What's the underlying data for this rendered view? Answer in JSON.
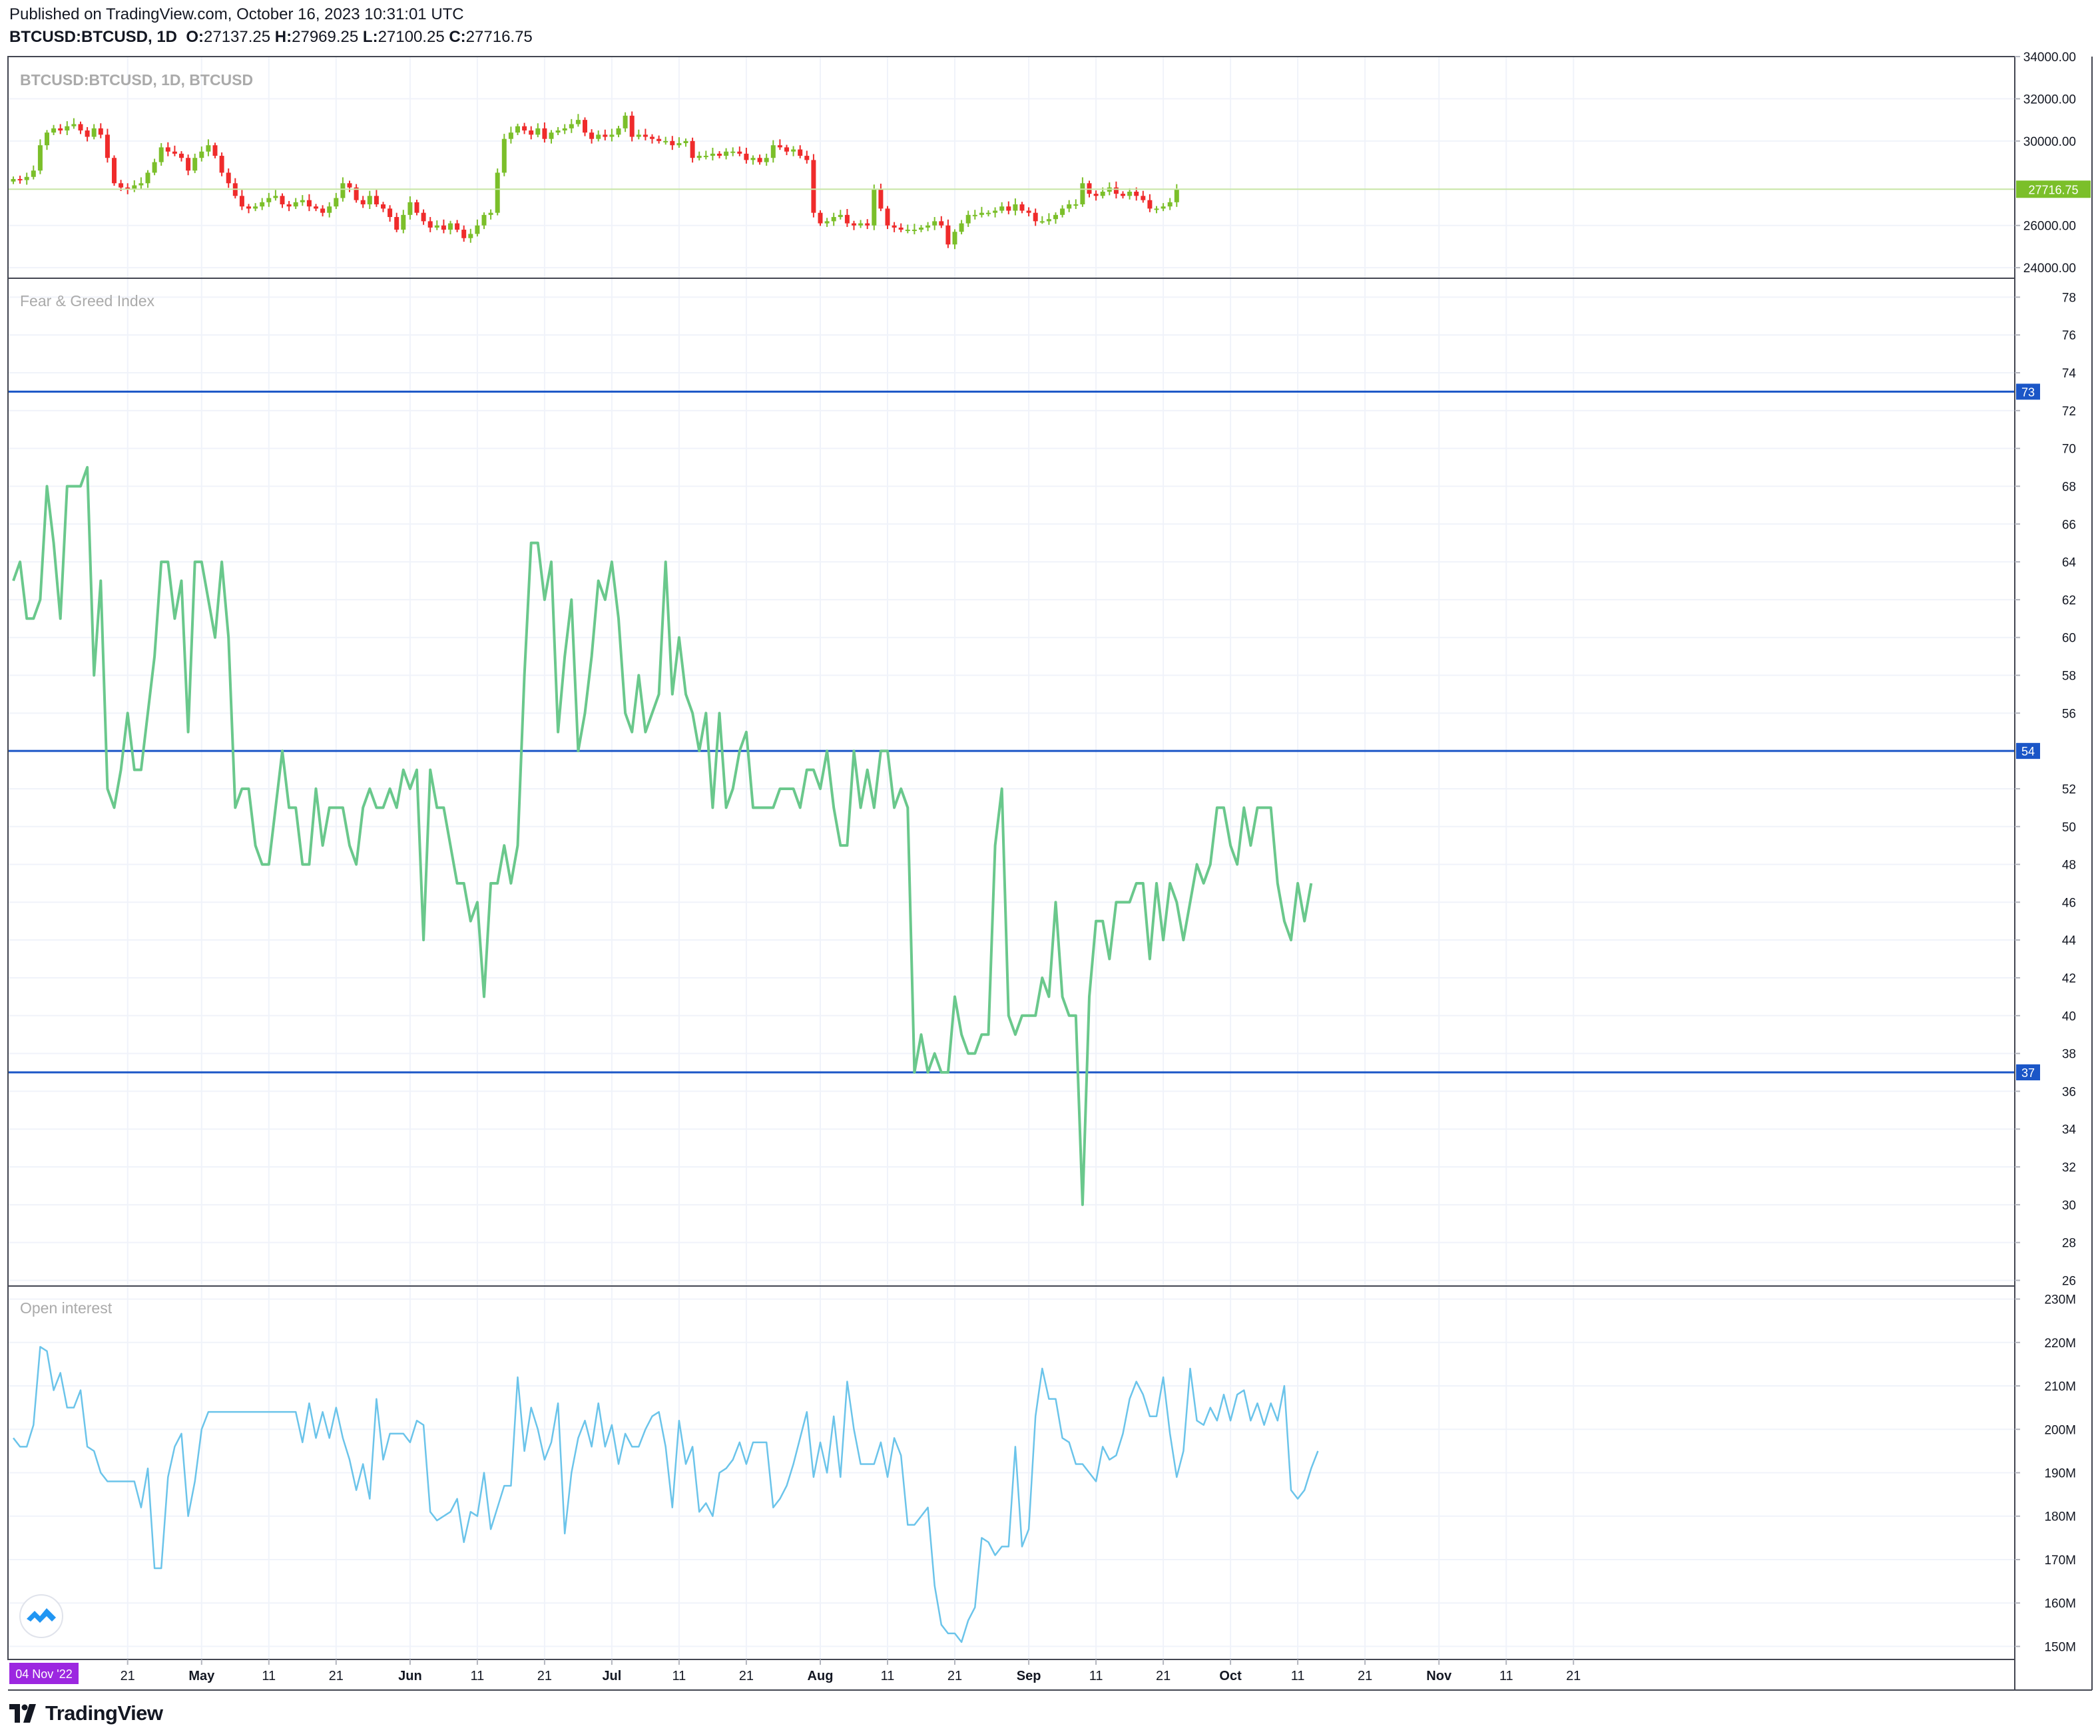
{
  "header": {
    "published": "Published on TradingView.com, October 16, 2023 10:31:01 UTC",
    "symbol": "BTCUSD:BTCUSD, 1D",
    "ohlc": {
      "o_label": "O:",
      "o": "27137.25",
      "h_label": "H:",
      "h": "27969.25",
      "l_label": "L:",
      "l": "27100.25",
      "c_label": "C:",
      "c": "27716.75"
    }
  },
  "footer": {
    "brand": "TradingView"
  },
  "colors": {
    "up": "#7bbf2a",
    "down": "#ef2b2b",
    "fng_line": "#6ac88c",
    "oi_line": "#6bc4ea",
    "hline": "#1b56c7",
    "last_price": "#7bbf2a",
    "date_badge": "#9c27e0",
    "grid": "#f0f3fa"
  },
  "x_axis": {
    "labels": [
      "21",
      "May",
      "11",
      "21",
      "Jun",
      "11",
      "21",
      "Jul",
      "11",
      "21",
      "Aug",
      "11",
      "21",
      "Sep",
      "11",
      "21",
      "Oct",
      "11",
      "21",
      "Nov",
      "11",
      "21"
    ],
    "first_date_badge": "04 Nov '22"
  },
  "chart_data": [
    {
      "type": "candlestick",
      "title": "BTCUSD:BTCUSD, 1D, BTCUSD",
      "y_ticks": [
        "34000.00",
        "32000.00",
        "30000.00",
        "26000.00",
        "24000.00"
      ],
      "ylim": [
        23500,
        34000
      ],
      "last_value_label": "27716.75",
      "last_value": 27716.75,
      "close": [
        28200,
        28150,
        28300,
        28600,
        29800,
        30400,
        30600,
        30500,
        30700,
        30800,
        30500,
        30200,
        30600,
        30300,
        29200,
        28000,
        27800,
        27700,
        27900,
        28000,
        28500,
        29000,
        29700,
        29500,
        29400,
        29200,
        28600,
        29200,
        29500,
        29800,
        29300,
        28500,
        28000,
        27400,
        26900,
        26800,
        26900,
        27100,
        27300,
        27400,
        27000,
        26900,
        27100,
        27200,
        26900,
        26800,
        26600,
        26900,
        27300,
        28000,
        27800,
        27200,
        27000,
        27400,
        27000,
        26800,
        26400,
        25800,
        26500,
        27100,
        26600,
        26200,
        25900,
        26000,
        25800,
        26100,
        25800,
        25400,
        25600,
        26000,
        26500,
        26600,
        28500,
        30100,
        30400,
        30700,
        30500,
        30300,
        30600,
        30100,
        30400,
        30500,
        30600,
        30800,
        31000,
        30400,
        30100,
        30300,
        30200,
        30300,
        30600,
        31200,
        30200,
        30300,
        30200,
        30100,
        30000,
        30000,
        29800,
        29900,
        30000,
        29200,
        29300,
        29300,
        29400,
        29300,
        29500,
        29500,
        29400,
        29100,
        29200,
        29000,
        29200,
        29800,
        29700,
        29500,
        29600,
        29300,
        29100,
        26600,
        26100,
        26200,
        26400,
        26500,
        26100,
        26000,
        26100,
        26000,
        27700,
        26800,
        26000,
        25900,
        25800,
        25800,
        25800,
        25900,
        26000,
        26200,
        26000,
        25100,
        25700,
        26100,
        26500,
        26500,
        26600,
        26600,
        26700,
        26900,
        26700,
        27000,
        26700,
        26600,
        26200,
        26200,
        26300,
        26500,
        26800,
        27000,
        27000,
        28000,
        27500,
        27400,
        27600,
        27800,
        27500,
        27400,
        27600,
        27400,
        27200,
        26800,
        26800,
        26900,
        27100,
        27716.75
      ]
    },
    {
      "type": "line",
      "title": "Fear & Greed Index",
      "y_ticks": [
        "78",
        "76",
        "74",
        "72",
        "70",
        "68",
        "66",
        "64",
        "62",
        "60",
        "58",
        "56",
        "52",
        "50",
        "48",
        "46",
        "44",
        "42",
        "40",
        "38",
        "36",
        "34",
        "32",
        "30",
        "28",
        "26"
      ],
      "ylim": [
        25.7,
        79
      ],
      "horizontal_lines": [
        73,
        54,
        37
      ],
      "y": [
        63,
        64,
        61,
        61,
        62,
        68,
        65,
        61,
        68,
        68,
        68,
        69,
        58,
        63,
        52,
        51,
        53,
        56,
        53,
        53,
        56,
        59,
        64,
        64,
        61,
        63,
        55,
        64,
        64,
        62,
        60,
        64,
        60,
        51,
        52,
        52,
        49,
        48,
        48,
        51,
        54,
        51,
        51,
        48,
        48,
        52,
        49,
        51,
        51,
        51,
        49,
        48,
        51,
        52,
        51,
        51,
        52,
        51,
        53,
        52,
        53,
        44,
        53,
        51,
        51,
        49,
        47,
        47,
        45,
        46,
        41,
        47,
        47,
        49,
        47,
        49,
        58,
        65,
        65,
        62,
        64,
        55,
        59,
        62,
        54,
        56,
        59,
        63,
        62,
        64,
        61,
        56,
        55,
        58,
        55,
        56,
        57,
        64,
        57,
        60,
        57,
        56,
        54,
        56,
        51,
        56,
        51,
        52,
        54,
        55,
        51,
        51,
        51,
        51,
        52,
        52,
        52,
        51,
        53,
        53,
        52,
        54,
        51,
        49,
        49,
        54,
        51,
        53,
        51,
        54,
        54,
        51,
        52,
        51,
        37,
        39,
        37,
        38,
        37,
        37,
        41,
        39,
        38,
        38,
        39,
        39,
        49,
        52,
        40,
        39,
        40,
        40,
        40,
        42,
        41,
        46,
        41,
        40,
        40,
        30,
        41,
        45,
        45,
        43,
        46,
        46,
        46,
        47,
        47,
        43,
        47,
        44,
        47,
        46,
        44,
        46,
        48,
        47,
        48,
        51,
        51,
        49,
        48,
        51,
        49,
        51,
        51,
        51,
        47,
        45,
        44,
        47,
        45,
        47
      ]
    },
    {
      "type": "line",
      "title": "Open interest",
      "y_ticks": [
        "230M",
        "220M",
        "210M",
        "200M",
        "190M",
        "180M",
        "170M",
        "160M",
        "150M"
      ],
      "ylim": [
        147,
        233
      ],
      "y": [
        198,
        196,
        196,
        201,
        219,
        218,
        209,
        213,
        205,
        205,
        209,
        196,
        195,
        190,
        188,
        188,
        188,
        188,
        188,
        182,
        191,
        168,
        168,
        189,
        196,
        199,
        180,
        188,
        200,
        204,
        204,
        204,
        204,
        204,
        204,
        204,
        204,
        204,
        204,
        204,
        204,
        204,
        204,
        197,
        206,
        198,
        204,
        198,
        205,
        198,
        193,
        186,
        192,
        184,
        207,
        193,
        199,
        199,
        199,
        197,
        202,
        201,
        181,
        179,
        180,
        181,
        184,
        174,
        181,
        180,
        190,
        177,
        182,
        187,
        187,
        212,
        195,
        205,
        200,
        193,
        197,
        206,
        176,
        190,
        198,
        202,
        196,
        206,
        196,
        201,
        192,
        199,
        196,
        196,
        200,
        203,
        204,
        196,
        182,
        202,
        192,
        196,
        181,
        183,
        180,
        190,
        191,
        193,
        197,
        192,
        197,
        197,
        197,
        182,
        184,
        187,
        192,
        198,
        204,
        189,
        197,
        190,
        203,
        189,
        211,
        200,
        192,
        192,
        192,
        197,
        189,
        198,
        194,
        178,
        178,
        180,
        182,
        164,
        155,
        153,
        153,
        151,
        156,
        159,
        175,
        174,
        171,
        173,
        173,
        196,
        173,
        177,
        203,
        214,
        207,
        207,
        198,
        197,
        192,
        192,
        190,
        188,
        196,
        193,
        194,
        199,
        207,
        211,
        208,
        203,
        203,
        212,
        199,
        189,
        195,
        214,
        202,
        201,
        205,
        202,
        208,
        202,
        208,
        209,
        202,
        206,
        201,
        206,
        202,
        210,
        186,
        184,
        186,
        191,
        195
      ]
    }
  ]
}
